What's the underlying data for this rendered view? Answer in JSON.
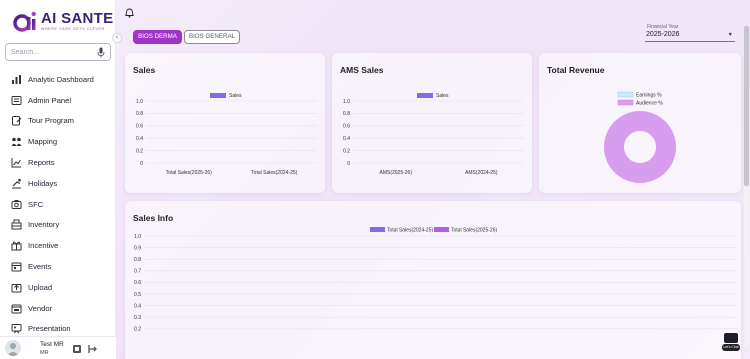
{
  "brand": {
    "name": "AI SANTE",
    "tagline": "WHERE CARE GETS CLEVER",
    "mark": "ai"
  },
  "search": {
    "placeholder": "Search..."
  },
  "sidebar": {
    "items": [
      {
        "label": "Analytic Dashboard",
        "icon": "analytics-icon"
      },
      {
        "label": "Admin Panel",
        "icon": "admin-panel-icon"
      },
      {
        "label": "Tour Program",
        "icon": "tour-program-icon"
      },
      {
        "label": "Mapping",
        "icon": "mapping-icon"
      },
      {
        "label": "Reports",
        "icon": "reports-icon"
      },
      {
        "label": "Holidays",
        "icon": "holidays-icon"
      },
      {
        "label": "SFC",
        "icon": "sfc-icon"
      },
      {
        "label": "Inventory",
        "icon": "inventory-icon"
      },
      {
        "label": "Incentive",
        "icon": "incentive-icon"
      },
      {
        "label": "Events",
        "icon": "events-icon"
      },
      {
        "label": "Upload",
        "icon": "upload-icon"
      },
      {
        "label": "Vendor",
        "icon": "vendor-icon"
      },
      {
        "label": "Presentation",
        "icon": "presentation-icon"
      }
    ]
  },
  "user": {
    "name": "Test MR",
    "role": "MR"
  },
  "tabs": [
    {
      "label": "BIOS DERMA",
      "active": true
    },
    {
      "label": "BIOS GENERAL",
      "active": false
    }
  ],
  "filters": {
    "financial_year_label": "Financial Year",
    "financial_year_value": "2025-2026"
  },
  "colors": {
    "accent": "#a033c8",
    "series_2024": "#7b6cf0",
    "series_2025": "#b45fe0",
    "earnings": "#cfe6fb",
    "audience": "#d79ef0"
  },
  "cards": {
    "sales_title": "Sales",
    "ams_title": "AMS Sales",
    "revenue_title": "Total Revenue",
    "sales_info_title": "Sales Info"
  },
  "float_widget": {
    "badge": "Let's Chat"
  },
  "chart_data": [
    {
      "type": "bar",
      "title": "Sales",
      "categories": [
        "Total Sales(2025-26)",
        "Total Sales(2024-25)"
      ],
      "series": [
        {
          "name": "Sales",
          "values": [
            0,
            0
          ]
        }
      ],
      "ylim": [
        0,
        1
      ],
      "yticks": [
        "0",
        "0.2",
        "0.4",
        "0.6",
        "0.8",
        "1.0"
      ],
      "legend": "top",
      "grid": true
    },
    {
      "type": "bar",
      "title": "AMS Sales",
      "categories": [
        "AMS(2025-26)",
        "AMS(2024-25)"
      ],
      "series": [
        {
          "name": "Sales",
          "values": [
            0,
            0
          ]
        }
      ],
      "ylim": [
        0,
        1
      ],
      "yticks": [
        "0",
        "0.2",
        "0.4",
        "0.6",
        "0.8",
        "1.0"
      ],
      "legend": "top",
      "grid": true
    },
    {
      "type": "pie",
      "title": "Total Revenue",
      "labels": [
        "Earnings %",
        "Audience %"
      ],
      "values": [
        0,
        100
      ],
      "legend": "top"
    },
    {
      "type": "bar",
      "title": "Sales Info",
      "series": [
        {
          "name": "Total Sales(2024-25)",
          "values": []
        },
        {
          "name": "Total Sales(2025-26)",
          "values": []
        }
      ],
      "ylim": [
        0,
        1
      ],
      "yticks": [
        "0.2",
        "0.3",
        "0.4",
        "0.5",
        "0.6",
        "0.7",
        "0.8",
        "0.9",
        "1.0"
      ],
      "legend": "top",
      "grid": true
    }
  ]
}
